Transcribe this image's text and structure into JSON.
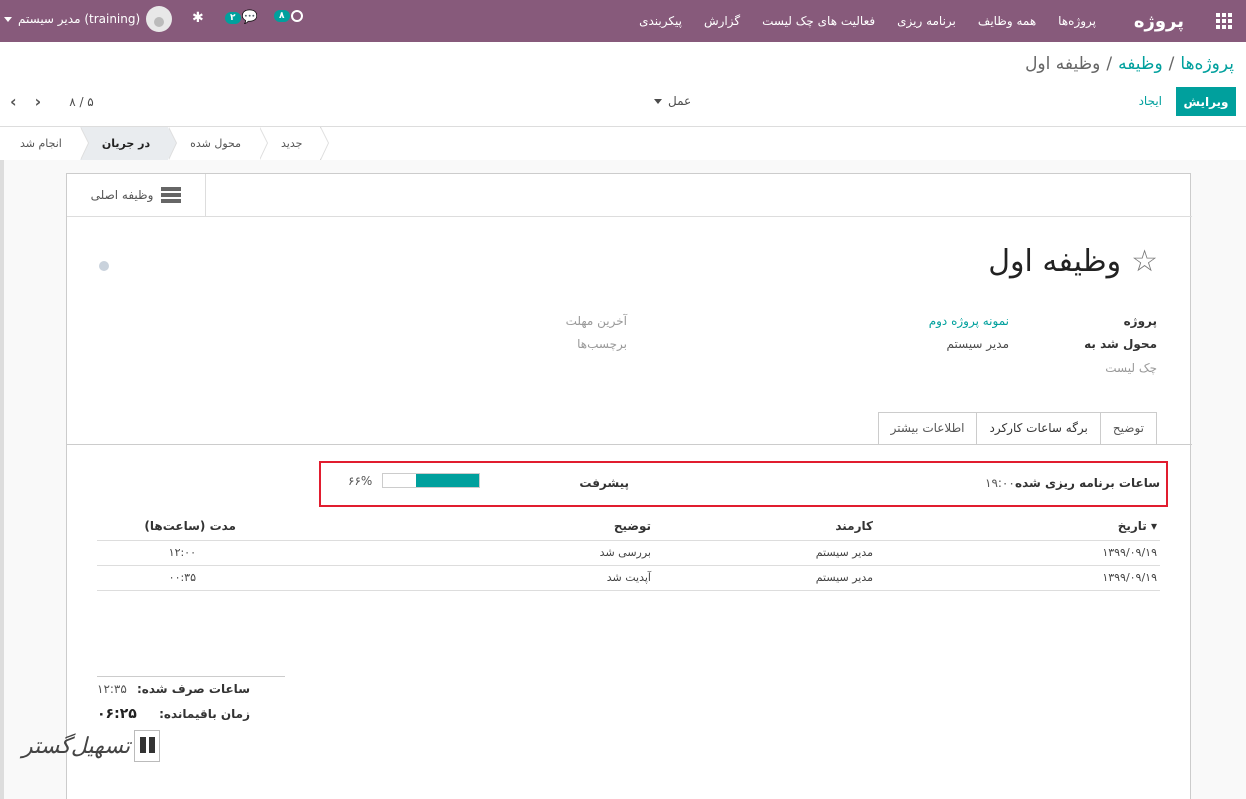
{
  "topbar": {
    "brand": "پروژه",
    "menu": [
      "پروژه‌ها",
      "همه وظایف",
      "برنامه ریزی",
      "فعالیت های چک لیست",
      "گزارش",
      "پیکربندی"
    ],
    "user_name": "مدیر سیستم (training)",
    "messages_count": "۲",
    "activities_count": "۸",
    "accent_color": "#875a7b"
  },
  "breadcrumb": {
    "root": "پروژه‌ها",
    "middle": "وظیفه",
    "current": "وظیفه اول"
  },
  "control": {
    "edit_label": "ویرایش",
    "create_label": "ایجاد",
    "action_label": "عمل",
    "pager_value": "۸ / ۵"
  },
  "stages": [
    "جدید",
    "محول شده",
    "در جریان",
    "انجام شد"
  ],
  "active_stage": "در جریان",
  "smart_button": {
    "label": "وظیفه اصلی",
    "icon": "list-icon"
  },
  "task": {
    "title": "وظیفه اول",
    "project_label": "پروژه",
    "project_value": "نمونه پروژه دوم",
    "assigned_label": "محول شد به",
    "assigned_value": "مدیر سیستم",
    "checklist_label": "چک لیست",
    "deadline_label": "آخرین مهلت",
    "tags_label": "برچسب‌ها"
  },
  "tabs": [
    "توضیح",
    "برگه ساعات کارکرد",
    "اطلاعات بیشتر"
  ],
  "active_tab": "برگه ساعات کارکرد",
  "planning": {
    "planned_label": "ساعات برنامه ریزی شده",
    "planned_value": "۱۹:۰۰",
    "progress_label": "پیشرفت",
    "progress_text": "۶۶%",
    "progress_percent": 66
  },
  "timesheet": {
    "headers": {
      "date": "تاریخ",
      "employee": "کارمند",
      "description": "توضیح",
      "duration": "مدت (ساعت‌ها)"
    },
    "rows": [
      {
        "date": "۱۳۹۹/۰۹/۱۹",
        "employee": "مدیر سیستم",
        "description": "بررسی شد",
        "duration": "۱۲:۰۰"
      },
      {
        "date": "۱۳۹۹/۰۹/۱۹",
        "employee": "مدیر سیستم",
        "description": "آپدیت شد",
        "duration": "۰۰:۳۵"
      }
    ]
  },
  "summary": {
    "spent_label": "ساعات صرف شده:",
    "spent_value": "۱۲:۳۵",
    "remaining_label": "زمان باقیمانده:",
    "remaining_value": "۰۶:۲۵"
  },
  "watermark": {
    "text": "تسهیل‌گستر"
  }
}
